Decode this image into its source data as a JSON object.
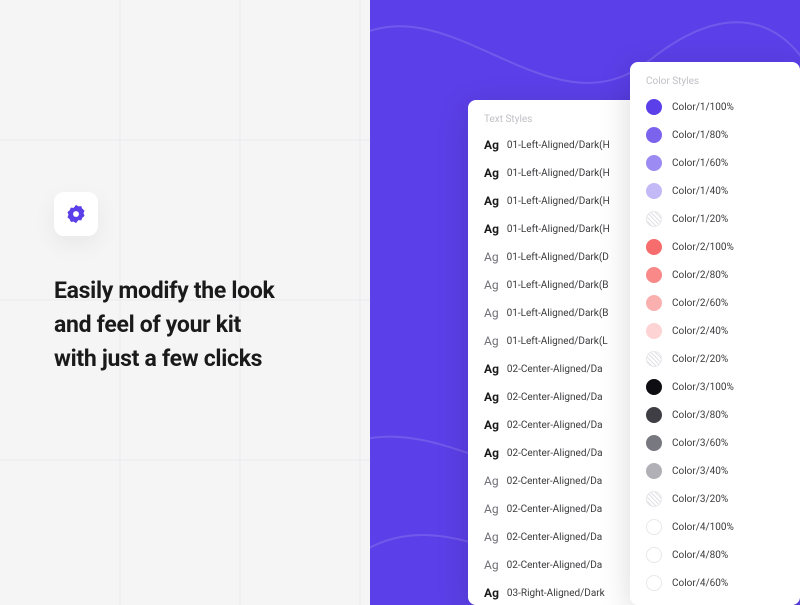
{
  "headline_l1": "Easily modify the look",
  "headline_l2": "and feel of your kit",
  "headline_l3": "with just a few clicks",
  "text_panel": {
    "title": "Text Styles",
    "items": [
      {
        "bold": true,
        "label": "01-Left-Aligned/Dark(H"
      },
      {
        "bold": true,
        "label": "01-Left-Aligned/Dark(H"
      },
      {
        "bold": true,
        "label": "01-Left-Aligned/Dark(H"
      },
      {
        "bold": true,
        "label": "01-Left-Aligned/Dark(H"
      },
      {
        "bold": false,
        "label": "01-Left-Aligned/Dark(D"
      },
      {
        "bold": false,
        "label": "01-Left-Aligned/Dark(B"
      },
      {
        "bold": false,
        "label": "01-Left-Aligned/Dark(B"
      },
      {
        "bold": false,
        "label": "01-Left-Aligned/Dark(L"
      },
      {
        "bold": true,
        "label": "02-Center-Aligned/Da"
      },
      {
        "bold": true,
        "label": "02-Center-Aligned/Da"
      },
      {
        "bold": true,
        "label": "02-Center-Aligned/Da"
      },
      {
        "bold": true,
        "label": "02-Center-Aligned/Da"
      },
      {
        "bold": false,
        "label": "02-Center-Aligned/Da"
      },
      {
        "bold": false,
        "label": "02-Center-Aligned/Da"
      },
      {
        "bold": false,
        "label": "02-Center-Aligned/Da"
      },
      {
        "bold": false,
        "label": "02-Center-Aligned/Da"
      },
      {
        "bold": true,
        "label": "03-Right-Aligned/Dark"
      }
    ]
  },
  "color_panel": {
    "title": "Color Styles",
    "items": [
      {
        "color": "#5B3FE8",
        "label": "Color/1/100%",
        "hatched": false,
        "border": false
      },
      {
        "color": "#7B63EE",
        "label": "Color/1/80%",
        "hatched": false,
        "border": false
      },
      {
        "color": "#9C8BF2",
        "label": "Color/1/60%",
        "hatched": false,
        "border": false
      },
      {
        "color": "#C3B9F7",
        "label": "Color/1/40%",
        "hatched": false,
        "border": false
      },
      {
        "color": "",
        "label": "Color/1/20%",
        "hatched": true,
        "border": false
      },
      {
        "color": "#F76C6C",
        "label": "Color/2/100%",
        "hatched": false,
        "border": false
      },
      {
        "color": "#F98989",
        "label": "Color/2/80%",
        "hatched": false,
        "border": false
      },
      {
        "color": "#FBB0B0",
        "label": "Color/2/60%",
        "hatched": false,
        "border": false
      },
      {
        "color": "#FDD3D3",
        "label": "Color/2/40%",
        "hatched": false,
        "border": false
      },
      {
        "color": "",
        "label": "Color/2/20%",
        "hatched": true,
        "border": false
      },
      {
        "color": "#0E0E12",
        "label": "Color/3/100%",
        "hatched": false,
        "border": false
      },
      {
        "color": "#3E3E44",
        "label": "Color/3/80%",
        "hatched": false,
        "border": false
      },
      {
        "color": "#787880",
        "label": "Color/3/60%",
        "hatched": false,
        "border": false
      },
      {
        "color": "#B0B0B6",
        "label": "Color/3/40%",
        "hatched": false,
        "border": false
      },
      {
        "color": "",
        "label": "Color/3/20%",
        "hatched": true,
        "border": false
      },
      {
        "color": "#FFFFFF",
        "label": "Color/4/100%",
        "hatched": false,
        "border": true
      },
      {
        "color": "#FFFFFF",
        "label": "Color/4/80%",
        "hatched": false,
        "border": true
      },
      {
        "color": "#FFFFFF",
        "label": "Color/4/60%",
        "hatched": false,
        "border": true
      }
    ]
  }
}
